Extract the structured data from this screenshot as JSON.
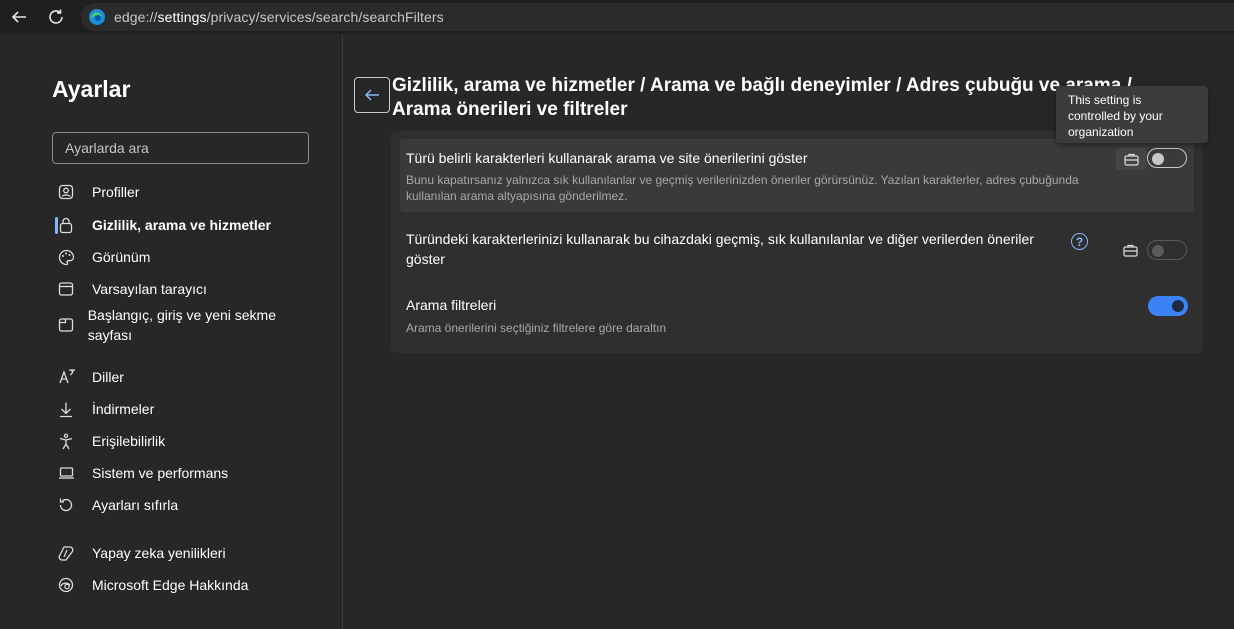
{
  "browser": {
    "url_scheme": "edge://",
    "url_host": "settings",
    "url_path": "/privacy/services/search/searchFilters"
  },
  "sidebar": {
    "title": "Ayarlar",
    "search_placeholder": "Ayarlarda ara",
    "items": [
      {
        "label": "Profiller",
        "icon": "profile-icon"
      },
      {
        "label": "Gizlilik, arama ve hizmetler",
        "icon": "lock-icon",
        "active": true
      },
      {
        "label": "Görünüm",
        "icon": "palette-icon"
      },
      {
        "label": "Varsayılan tarayıcı",
        "icon": "browser-window-icon"
      },
      {
        "label": "Başlangıç, giriş ve yeni sekme sayfası",
        "icon": "tabs-icon"
      },
      {
        "label": "Diller",
        "icon": "language-icon"
      },
      {
        "label": "İndirmeler",
        "icon": "download-icon"
      },
      {
        "label": "Erişilebilirlik",
        "icon": "accessibility-icon"
      },
      {
        "label": "Sistem ve performans",
        "icon": "laptop-icon"
      },
      {
        "label": "Ayarları sıfırla",
        "icon": "reset-icon"
      },
      {
        "label": "Yapay zeka yenilikleri",
        "icon": "ai-sparkle-icon"
      },
      {
        "label": "Microsoft Edge Hakkında",
        "icon": "edge-logo-icon"
      }
    ]
  },
  "content": {
    "breadcrumb_line1": "Gizlilik, arama ve hizmetler / Arama ve bağlı deneyimler / Adres çubuğu ve arama /",
    "breadcrumb_line2": "Arama önerileri ve filtreler",
    "settings": [
      {
        "title": "Türü belirli karakterleri kullanarak arama ve site önerilerini göster",
        "description": "Bunu kapatırsanız yalnızca sık kullanılanlar ve geçmiş verilerinizden öneriler görürsünüz. Yazılan karakterler, adres çubuğunda kullanılan arama altyapısına gönderilmez.",
        "enabled": false,
        "managed": true
      },
      {
        "title": "Türündeki karakterlerinizi kullanarak bu cihazdaki geçmiş, sık kullanılanlar ve diğer verilerden öneriler göster",
        "description": "",
        "enabled": false,
        "managed": true,
        "help": "?"
      },
      {
        "title": "Arama filtreleri",
        "description": "Arama önerilerini seçtiğiniz filtrelere göre daraltın",
        "enabled": true,
        "managed": false
      }
    ],
    "tooltip": "This setting is controlled by your organization"
  },
  "colors": {
    "accent": "#8ab4f8",
    "toggle_on": "#3b82f6",
    "background": "#272727",
    "card": "#2f2f2f"
  }
}
